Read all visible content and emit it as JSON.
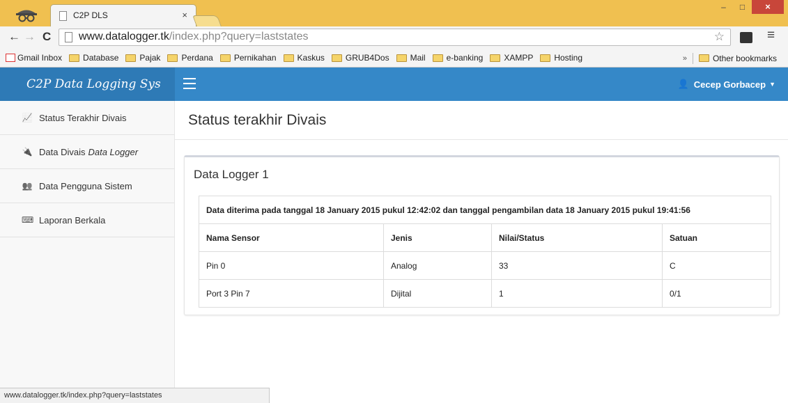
{
  "browser": {
    "tab_title": "C2P DLS",
    "tab_close": "×",
    "window": {
      "minimize": "–",
      "maximize": "□",
      "close": "×"
    },
    "url_domain": "www.datalogger.tk",
    "url_path": "/index.php?query=laststates",
    "bookmarks": [
      {
        "label": "Gmail Inbox",
        "icon": "gmail-icon"
      },
      {
        "label": "Database",
        "icon": "folder-icon"
      },
      {
        "label": "Pajak",
        "icon": "folder-icon"
      },
      {
        "label": "Perdana",
        "icon": "folder-icon"
      },
      {
        "label": "Pernikahan",
        "icon": "folder-icon"
      },
      {
        "label": "Kaskus",
        "icon": "folder-icon"
      },
      {
        "label": "GRUB4Dos",
        "icon": "folder-icon"
      },
      {
        "label": "Mail",
        "icon": "folder-icon"
      },
      {
        "label": "e-banking",
        "icon": "folder-icon"
      },
      {
        "label": "XAMPP",
        "icon": "folder-icon"
      },
      {
        "label": "Hosting",
        "icon": "folder-icon"
      }
    ],
    "bookmarks_overflow": "»",
    "other_bookmarks": "Other bookmarks",
    "status_bar": "www.datalogger.tk/index.php?query=laststates"
  },
  "app": {
    "brand": "C2P Data Logging Sys",
    "user_name": "Cecep Gorbacep",
    "sidebar": [
      {
        "label": "Status Terakhir Divais",
        "emphasis": "",
        "icon": "line-chart-icon"
      },
      {
        "label": "Data Divais",
        "emphasis": "Data Logger",
        "icon": "plug-icon"
      },
      {
        "label": "Data Pengguna Sistem",
        "emphasis": "",
        "icon": "users-icon"
      },
      {
        "label": "Laporan Berkala",
        "emphasis": "",
        "icon": "keyboard-icon"
      }
    ],
    "page_title": "Status terakhir Divais",
    "panel": {
      "title": "Data Logger 1",
      "caption": "Data diterima pada tanggal 18 January 2015 pukul 12:42:02 dan tanggal pengambilan data 18 January 2015 pukul 19:41:56",
      "columns": [
        "Nama Sensor",
        "Jenis",
        "Nilai/Status",
        "Satuan"
      ],
      "rows": [
        [
          "Pin 0",
          "Analog",
          "33",
          "C"
        ],
        [
          "Port 3 Pin 7",
          "Dijital",
          "1",
          "0/1"
        ]
      ]
    }
  },
  "colors": {
    "chrome_frame": "#f0c050",
    "navbar": "#3588c8",
    "brand_bg": "#2e7ab6"
  }
}
